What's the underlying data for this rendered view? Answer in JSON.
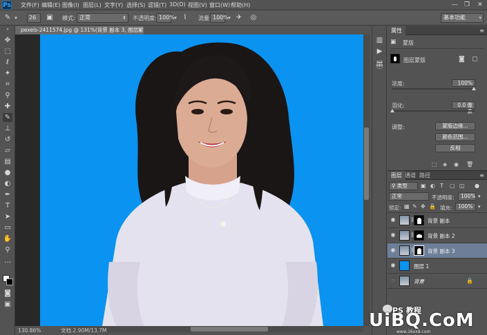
{
  "menubar": {
    "logo": "Ps",
    "items": [
      "文件(F)",
      "编辑(E)",
      "图像(I)",
      "图层(L)",
      "文字(Y)",
      "选择(S)",
      "滤镜(T)",
      "3D(D)",
      "视图(V)",
      "窗口(W)",
      "帮助(H)"
    ],
    "minimize": "—",
    "restore": "❐",
    "close": "✕"
  },
  "options": {
    "brush_size": "26",
    "mode_label": "模式:",
    "mode_value": "正常",
    "opacity_label": "不透明度:",
    "opacity_value": "100%",
    "flow_label": "流量:",
    "flow_value": "100%",
    "workspace": "基本功能"
  },
  "document": {
    "tab_title": "pexels-2411574.jpg @ 131%(背景 副本 3, 图层蒙版/8) *",
    "tab_close": "×",
    "zoom": "130.86%",
    "doc_info": "文档:2.90M/13.7M"
  },
  "colors": {
    "canvas_bg": "#0a93f0",
    "foreground": "#ffffff",
    "background": "#000000"
  },
  "properties": {
    "tab": "属性",
    "mask_title": "蒙版",
    "layer_mask_label": "图层蒙版",
    "density_label": "浓度:",
    "density_value": "100%",
    "feather_label": "羽化:",
    "feather_value": "0.0 像素",
    "adjust_label": "调整:",
    "btn_mask_edge": "蒙版边缘...",
    "btn_color_range": "颜色范围...",
    "btn_invert": "反相"
  },
  "layers": {
    "tabs": [
      "图层",
      "通道",
      "路径"
    ],
    "kind_label": "类型",
    "blend_mode": "正常",
    "opacity_label": "不透明度:",
    "opacity_value": "100%",
    "lock_label": "锁定:",
    "fill_label": "填充:",
    "fill_value": "100%",
    "rows": [
      {
        "name": "背景 副本",
        "selected": false
      },
      {
        "name": "背景 副本 2",
        "selected": false
      },
      {
        "name": "背景 副本 3",
        "selected": true
      },
      {
        "name": "图层 1",
        "selected": false
      },
      {
        "name": "背景",
        "selected": false
      }
    ]
  },
  "watermark": {
    "logo": "UiBQ.CoM",
    "top": "PS 教程",
    "sub": "www.16xx8.com"
  }
}
